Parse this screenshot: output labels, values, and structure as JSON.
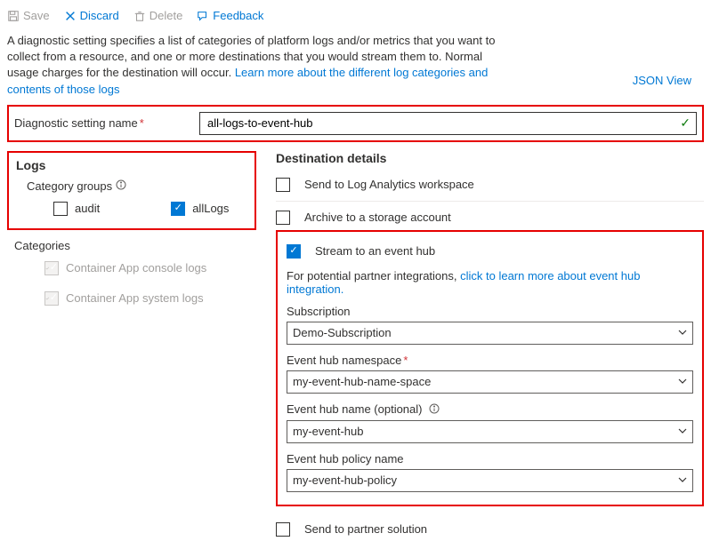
{
  "toolbar": {
    "save": "Save",
    "discard": "Discard",
    "delete": "Delete",
    "feedback": "Feedback"
  },
  "intro": {
    "text": "A diagnostic setting specifies a list of categories of platform logs and/or metrics that you want to collect from a resource, and one or more destinations that you would stream them to. Normal usage charges for the destination will occur. ",
    "learnMore": "Learn more about the different log categories and contents of those logs"
  },
  "jsonView": "JSON View",
  "settingName": {
    "label": "Diagnostic setting name",
    "value": "all-logs-to-event-hub"
  },
  "logs": {
    "heading": "Logs",
    "categoryGroupsLabel": "Category groups",
    "audit": "audit",
    "allLogs": "allLogs",
    "categoriesLabel": "Categories",
    "cat1": "Container App console logs",
    "cat2": "Container App system logs"
  },
  "dest": {
    "heading": "Destination details",
    "logAnalytics": "Send to Log Analytics workspace",
    "archive": "Archive to a storage account",
    "eventHub": "Stream to an event hub",
    "partnerText": "For potential partner integrations, ",
    "partnerLink": "click to learn more about event hub integration.",
    "subscriptionLabel": "Subscription",
    "subscriptionValue": "Demo-Subscription",
    "ehNamespaceLabel": "Event hub namespace",
    "ehNamespaceValue": "my-event-hub-name-space",
    "ehNameLabel": "Event hub name (optional)",
    "ehNameValue": "my-event-hub",
    "ehPolicyLabel": "Event hub policy name",
    "ehPolicyValue": "my-event-hub-policy",
    "partnerSolution": "Send to partner solution"
  }
}
